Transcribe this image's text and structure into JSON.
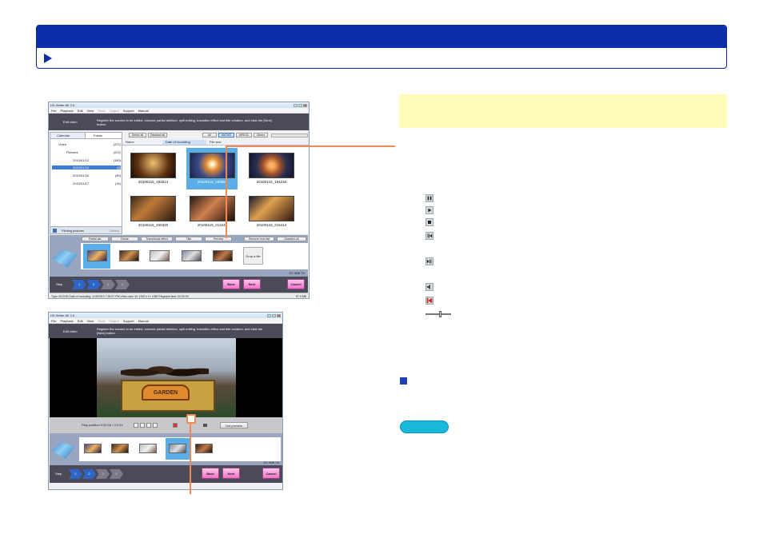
{
  "top_window": {
    "title": "HD Writer AE 2.6",
    "menu": [
      "File",
      "Playback",
      "Edit",
      "View",
      "Tools",
      "Output",
      "Support",
      "Manual"
    ],
    "step_title": "Edit video",
    "instruction": "Register the scenes to be edited, execute partial deletion, split editing, transition effect and title creation, and click the [Next] button.",
    "tabs": [
      "Calendar",
      "Folder"
    ],
    "toolbar": [
      "Select all",
      "Deselect all"
    ],
    "filter_buttons": [
      "All",
      "AVCHD",
      "MPEG2",
      "Others"
    ],
    "columns": [
      "Name",
      "Date of recording",
      "File size"
    ],
    "tree": [
      {
        "label": "Video",
        "count": "(222)"
      },
      {
        "label": "Pictures",
        "count": "(222)"
      },
      {
        "label": "2010/01/12",
        "count": "(180)"
      },
      {
        "label": "2010/01/15",
        "count": "(6)"
      },
      {
        "label": "2010/01/16",
        "count": "(45)"
      },
      {
        "label": "2010/01/17",
        "count": "(16)"
      }
    ],
    "thumbnails": [
      "20100115_193514",
      "20100115_193957",
      "20100115_194232",
      "20100115_200320",
      "20100115_212246",
      "20100115_215414"
    ],
    "left_bottom": [
      "Filming pictures",
      "Details"
    ],
    "edit_buttons": [
      "Partial del.",
      "Divide",
      "Transitional effect",
      "Title",
      "Preview",
      "Remove from list",
      "Deselect all"
    ],
    "drop_label": "Drop a file",
    "size_label": "207.0MB 7/0",
    "step_label": "Step",
    "steps": [
      "1",
      "2",
      "3",
      "4"
    ],
    "back": "Back",
    "next": "Next",
    "cancel": "Cancel",
    "status": "Type: AVCHD  Date of recording: 1/15/2010 7:35:37 PM  Video size: W: 1920 x H: 1080  Playback time: 00:00:00",
    "status_size": "57.9 MB"
  },
  "bottom_window": {
    "title": "HD Writer AE 2.6",
    "menu": [
      "File",
      "Playback",
      "Edit",
      "View",
      "Tools",
      "Output",
      "Support",
      "Manual"
    ],
    "step_title": "Edit video",
    "instruction": "Register the scenes to be edited, execute partial deletion, split editing, transition effect and title creation, and click the [Next] button.",
    "sign_text": "GARDEN",
    "play_label": "Play position  0:00:16 / 0:0:24",
    "list_button": "List preview",
    "size_label": "207.0MB 7/0",
    "step_label": "Step",
    "steps": [
      "1",
      "2",
      "3",
      "4"
    ],
    "back": "Back",
    "next": "Next",
    "cancel": "Cancel"
  },
  "colors": {
    "banner": "#0b2fa8",
    "orange_callout": "#f08a52",
    "note_bg": "#fefbb8",
    "pill": "#19b8d9",
    "pink_button": "#f070c8",
    "selection": "#5aaee8"
  },
  "icons": [
    "pause-icon",
    "play-icon",
    "stop-icon",
    "frame-back-icon",
    "frame-forward-icon",
    "volume-icon",
    "mute-icon",
    "slider-icon"
  ]
}
